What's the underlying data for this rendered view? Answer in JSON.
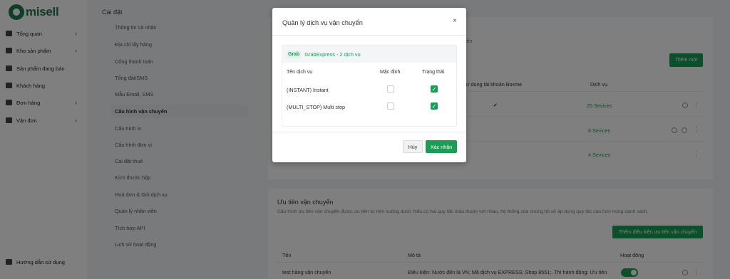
{
  "app": {
    "logo_text": "misell",
    "brand_color": "#1e7a4b",
    "accent": "#1a9e57"
  },
  "sidebar": {
    "items": [
      {
        "label": "Tổng quan",
        "icon": "home-icon",
        "has_children": true
      },
      {
        "label": "Kho sản phẩm",
        "icon": "box-icon",
        "has_children": true
      },
      {
        "label": "Sản phẩm đang bán",
        "icon": "shop-icon",
        "has_children": false
      },
      {
        "label": "Khách hàng",
        "icon": "users-icon",
        "has_children": false
      },
      {
        "label": "Đơn hàng",
        "icon": "order-icon",
        "has_children": true
      },
      {
        "label": "Vận đơn",
        "icon": "truck-icon",
        "has_children": true
      }
    ],
    "footer_label": "Hướng dẫn sử dụng",
    "chevron": "›"
  },
  "settings": {
    "title": "Cài đặt",
    "items": [
      "Thông tin cá nhân",
      "Địa chỉ lấy hàng",
      "Cổng thanh toán",
      "Tổng đài/SMS",
      "Mẫu Email, SMS",
      "Cấu hình vận chuyển",
      "Cấu hình in",
      "Cấu hình đơn vị",
      "Cài đặt thuế",
      "Kích thước hộp",
      "Hoá đơn & Gói dịch vụ",
      "Quản lý nhân viên",
      "Tích hợp API",
      "Lịch sử hoạt động"
    ],
    "active_index": 5
  },
  "shipping_card": {
    "partial_subtitle": "yển",
    "add_button": "Thêm mới",
    "col_boxme": "Sử dụng tài khoản Boxme",
    "col_services": "Dịch vụ",
    "rows": [
      {
        "services": "25 Sevices",
        "boxme_check": "✔"
      },
      {
        "services": "8 Sevices"
      },
      {
        "services": "4 Sevices"
      }
    ],
    "kebab": "⋮"
  },
  "priority_card": {
    "title": "Ưu tiên vận chuyển",
    "description": "Cấu hình ưu tiên vận chuyển được ưu tiên từ trên xuống dưới. Nếu có hai quy tắc mâu thuẫn với nhau, hệ thống của chúng tôi sẽ áp dụng quy tắc cao hơn trong danh sách.",
    "add_button": "Thêm điều kiện ưu tiên vận chuyển",
    "col_name": "Tên",
    "col_desc": "Mô tả",
    "col_active": "Hoạt động",
    "row": {
      "name": "test hãng vận chuyển",
      "desc": "Điều kiện: Nước đến là VN; Mã dịch vụ EXPRESS; Shop 8551;. Thì hành động: Ưu tiên"
    }
  },
  "modal": {
    "title": "Quản lý dịch vụ vận chuyển",
    "close": "×",
    "carrier_logo": "Grab",
    "carrier_name": "GrabExpress",
    "carrier_count": " - 2 dịch vụ",
    "col_service": "Tên dịch vụ",
    "col_default": "Mặc định",
    "col_status": "Trạng thái",
    "services": [
      {
        "name": "(INSTANT) Instant",
        "default": false,
        "status": true
      },
      {
        "name": "(MULTI_STOP) Multi stop",
        "default": false,
        "status": true
      }
    ],
    "check_mark": "✓",
    "cancel": "Hủy",
    "confirm": "Xác nhận"
  }
}
